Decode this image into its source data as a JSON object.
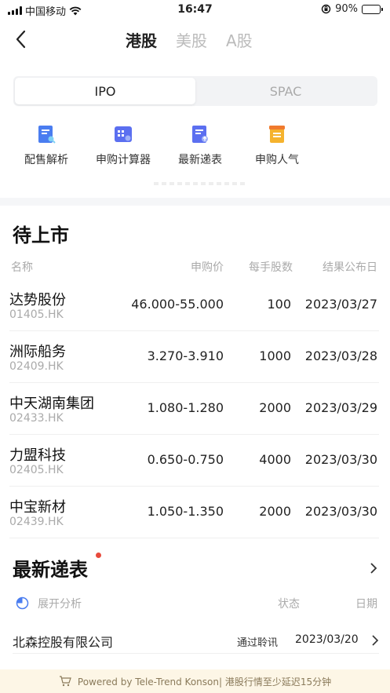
{
  "status_bar": {
    "carrier": "中国移动",
    "time": "16:47",
    "battery": "90%",
    "battery_level": 0.9
  },
  "nav": {
    "tabs": [
      {
        "label": "港股",
        "active": true
      },
      {
        "label": "美股",
        "active": false
      },
      {
        "label": "A股",
        "active": false
      }
    ]
  },
  "segment": {
    "options": [
      {
        "label": "IPO",
        "active": true
      },
      {
        "label": "SPAC",
        "active": false
      }
    ]
  },
  "tools": [
    {
      "label": "配售解析",
      "icon": "doc-search-icon",
      "color": "#4a7df0"
    },
    {
      "label": "申购计算器",
      "icon": "calculator-icon",
      "color": "#5b6ff0"
    },
    {
      "label": "最新递表",
      "icon": "doc-upload-icon",
      "color": "#5b6ff0"
    },
    {
      "label": "申购人气",
      "icon": "fire-doc-icon",
      "color": "#f5b32e"
    }
  ],
  "pending": {
    "title": "待上市",
    "headers": {
      "name": "名称",
      "price": "申购价",
      "lot": "每手股数",
      "date": "结果公布日"
    },
    "rows": [
      {
        "name": "达势股份",
        "code": "01405.HK",
        "price": "46.000-55.000",
        "lot": "100",
        "date": "2023/03/27"
      },
      {
        "name": "洲际船务",
        "code": "02409.HK",
        "price": "3.270-3.910",
        "lot": "1000",
        "date": "2023/03/28"
      },
      {
        "name": "中天湖南集团",
        "code": "02433.HK",
        "price": "1.080-1.280",
        "lot": "2000",
        "date": "2023/03/29"
      },
      {
        "name": "力盟科技",
        "code": "02405.HK",
        "price": "0.650-0.750",
        "lot": "4000",
        "date": "2023/03/30"
      },
      {
        "name": "中宝新材",
        "code": "02439.HK",
        "price": "1.050-1.350",
        "lot": "2000",
        "date": "2023/03/30"
      }
    ]
  },
  "filings": {
    "title": "最新递表",
    "expand_label": "展开分析",
    "status_header": "状态",
    "date_header": "日期",
    "rows": [
      {
        "company": "北森控股有限公司",
        "status": "通过聆讯",
        "date": "2023/03/20"
      }
    ]
  },
  "footer": {
    "text": "Powered by Tele-Trend Konson| 港股行情至少延迟15分钟"
  },
  "colors": {
    "accent": "#4a7df0",
    "dot": "#e84a3c",
    "footer_bg": "#fdf6e6"
  }
}
